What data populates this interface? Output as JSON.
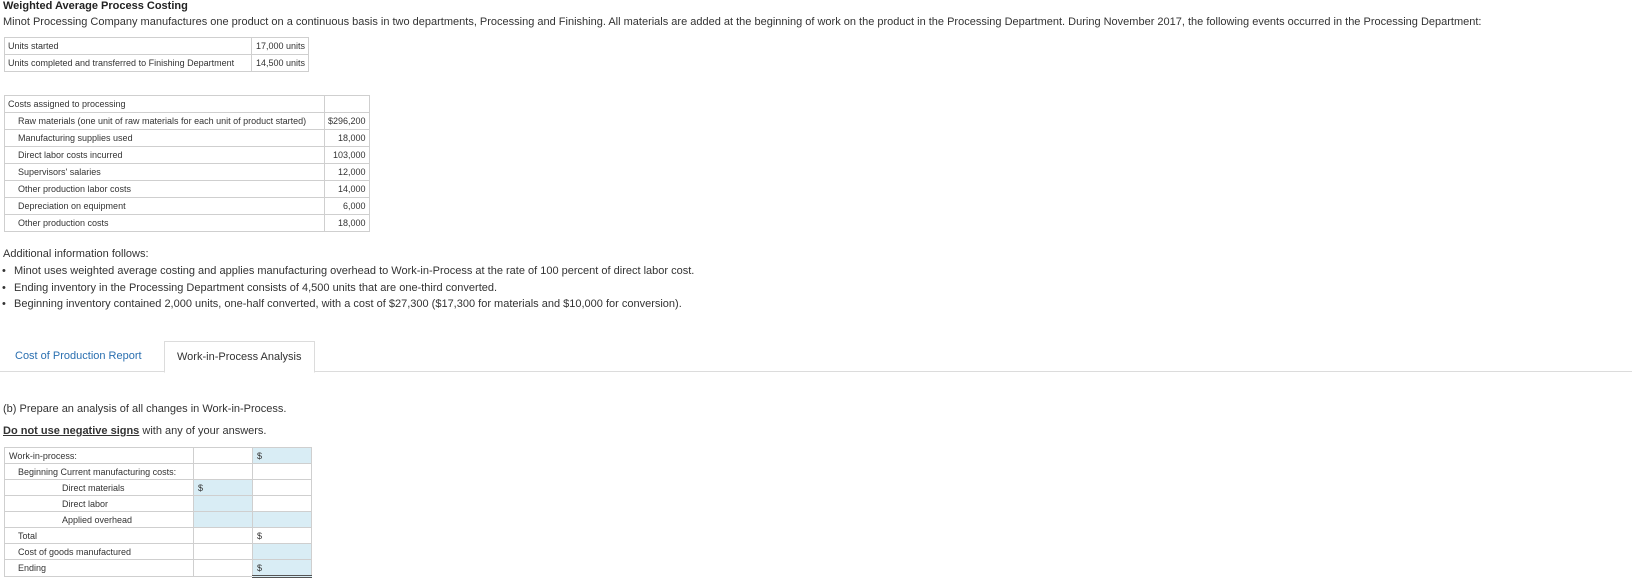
{
  "title": "Weighted Average Process Costing",
  "intro": "Minot Processing Company manufactures one product on a continuous basis in two departments, Processing and Finishing. All materials are added at the beginning of work on the product in the Processing Department. During November 2017, the following events occurred in the Processing Department:",
  "units_table": [
    {
      "label": "Units started",
      "value": "17,000 units"
    },
    {
      "label": "Units completed and transferred to Finishing Department",
      "value": "14,500 units"
    }
  ],
  "costs_table": {
    "header": "Costs assigned to processing",
    "rows": [
      {
        "label": "Raw materials (one unit of raw materials for each unit of product started)",
        "value": "$296,200"
      },
      {
        "label": "Manufacturing supplies used",
        "value": "18,000"
      },
      {
        "label": "Direct labor costs incurred",
        "value": "103,000"
      },
      {
        "label": "Supervisors' salaries",
        "value": "12,000"
      },
      {
        "label": "Other production labor costs",
        "value": "14,000"
      },
      {
        "label": "Depreciation on equipment",
        "value": "6,000"
      },
      {
        "label": "Other production costs",
        "value": "18,000"
      }
    ]
  },
  "additional_label": "Additional information follows:",
  "bullets": [
    "Minot uses weighted average costing and applies manufacturing overhead to Work-in-Process at the rate of 100 percent of direct labor cost.",
    "Ending inventory in the Processing Department consists of 4,500 units that are one-third converted.",
    "Beginning inventory contained 2,000 units, one-half converted, with a cost of $27,300 ($17,300 for materials and $10,000 for conversion)."
  ],
  "tabs": [
    "Cost of Production Report",
    "Work-in-Process Analysis"
  ],
  "part_b_prompt": "(b) Prepare an analysis of all changes in Work-in-Process.",
  "no_negative_bold": "Do not use negative signs",
  "no_negative_rest": " with any of your answers.",
  "wip": {
    "header": "Work-in-process:",
    "beginning_label": "Beginning Current manufacturing costs:",
    "direct_materials": "Direct materials",
    "direct_labor": "Direct labor",
    "applied_overhead": "Applied overhead",
    "total": "Total",
    "cogm": "Cost of goods manufactured",
    "ending": "Ending",
    "currency": "$"
  }
}
